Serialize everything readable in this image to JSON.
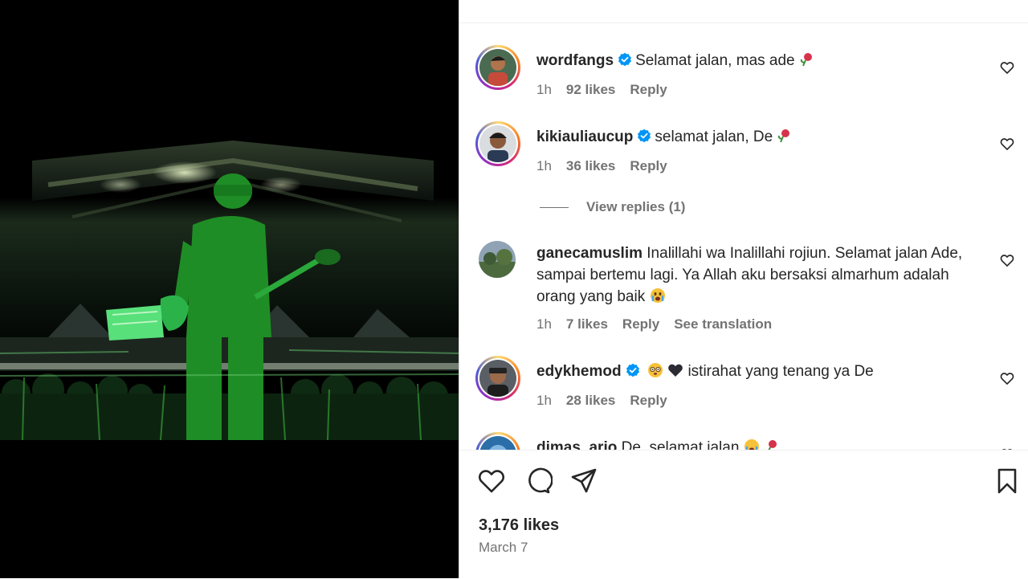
{
  "comments": [
    {
      "username": "wordfangs",
      "verified": true,
      "text": "Selamat jalan, mas ade",
      "emoji": [
        "rose-icon"
      ],
      "age": "1h",
      "likes": "92 likes",
      "reply": "Reply"
    },
    {
      "username": "kikiauliaucup",
      "verified": true,
      "text": "selamat jalan, De",
      "emoji": [
        "rose-icon"
      ],
      "age": "1h",
      "likes": "36 likes",
      "reply": "Reply"
    },
    {
      "username": "ganecamuslim",
      "verified": false,
      "text": "Inalillahi wa Inalillahi rojiun. Selamat jalan Ade, sampai bertemu lagi. Ya Allah aku bersaksi almarhum adalah orang yang baik",
      "emoji": [
        "crying-face-icon"
      ],
      "age": "1h",
      "likes": "7 likes",
      "reply": "Reply",
      "translate": "See translation"
    },
    {
      "username": "edykhemod",
      "verified": true,
      "pre_emoji": [
        "flushed-face-icon",
        "black-heart-icon"
      ],
      "text": "istirahat yang tenang ya De",
      "age": "1h",
      "likes": "28 likes",
      "reply": "Reply"
    },
    {
      "username": "dimas_ario",
      "verified": false,
      "text": "De, selamat jalan",
      "emoji": [
        "crying-face-icon",
        "rose-icon"
      ]
    }
  ],
  "view_replies": "View replies (1)",
  "likes_total": "3,176 likes",
  "post_date": "March 7",
  "icons": {
    "like": "heart-icon",
    "comment": "comment-icon",
    "share": "share-icon",
    "save": "bookmark-icon"
  },
  "colors": {
    "verified": "#0095f6",
    "secondary_text": "#737373",
    "media_tint": "#1fa32a"
  }
}
